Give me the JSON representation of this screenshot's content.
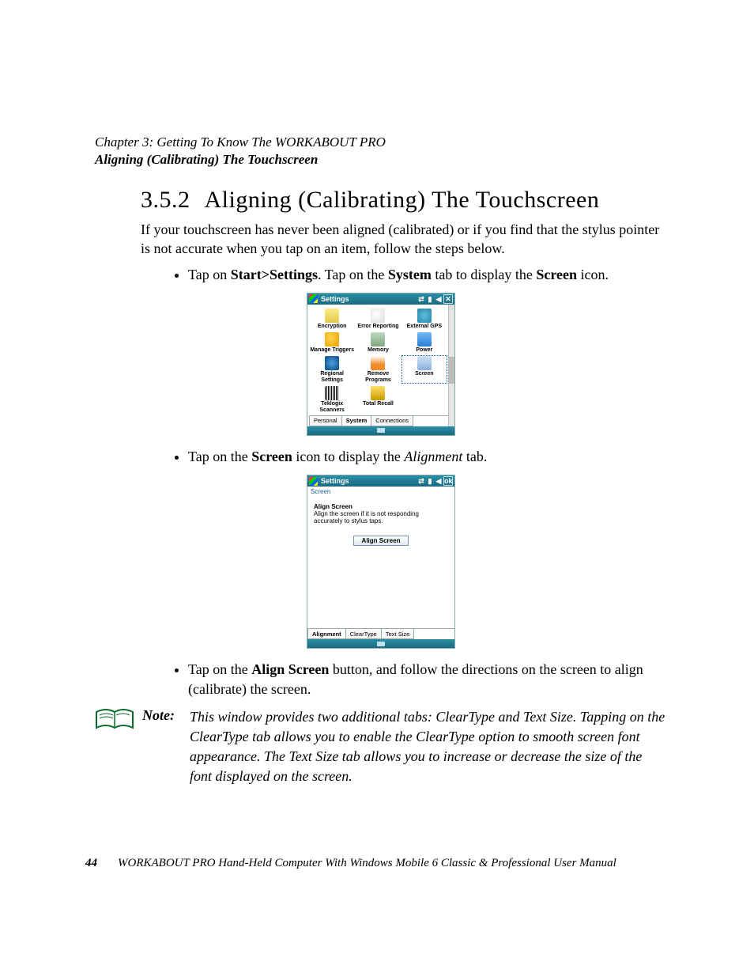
{
  "chapter": "Chapter  3:  Getting To Know The WORKABOUT PRO",
  "section_header": "Aligning (Calibrating) The Touchscreen",
  "heading_num": "3.5.2",
  "heading_text": "Aligning (Calibrating) The Touchscreen",
  "intro": "If your touchscreen has never been aligned (calibrated) or if you find that the stylus pointer is not accurate when you tap on an item, follow the steps below.",
  "step1": {
    "pre": "Tap on ",
    "b1": "Start>Settings",
    "mid1": ". Tap on the ",
    "b2": "System",
    "mid2": " tab to display the ",
    "b3": "Screen",
    "post": " icon."
  },
  "step2": {
    "pre": "Tap on the ",
    "b1": "Screen",
    "mid1": " icon to display the ",
    "i1": "Alignment",
    "post": " tab."
  },
  "step3": {
    "pre": "Tap on the ",
    "b1": "Align Screen",
    "post": " button, and follow the directions on the screen to align (calibrate) the screen."
  },
  "device1": {
    "title": "Settings",
    "icons": [
      "Encryption",
      "Error Reporting",
      "External GPS",
      "Manage Triggers",
      "Memory",
      "Power",
      "Regional Settings",
      "Remove Programs",
      "Screen",
      "Teklogix Scanners",
      "Total Recall"
    ],
    "tabs": [
      "Personal",
      "System",
      "Connections"
    ],
    "active_tab": 1,
    "selected_icon": 8
  },
  "device2": {
    "title": "Settings",
    "ok": "ok",
    "subtitle": "Screen",
    "pane_heading": "Align Screen",
    "pane_text": "Align the screen if it is not responding accurately to stylus taps.",
    "button": "Align Screen",
    "tabs": [
      "Alignment",
      "ClearType",
      "Text Size"
    ],
    "active_tab": 0
  },
  "note": {
    "label": "Note:",
    "text": "This window provides two additional tabs: ClearType and Text Size. Tapping on the ClearType tab allows you to enable the ClearType option to smooth screen font appearance. The Text Size tab allows you to increase or decrease the size of the font displayed on the screen."
  },
  "footer": {
    "page": "44",
    "text": "WORKABOUT PRO Hand-Held Computer With Windows Mobile 6 Classic & Professional User Manual"
  }
}
